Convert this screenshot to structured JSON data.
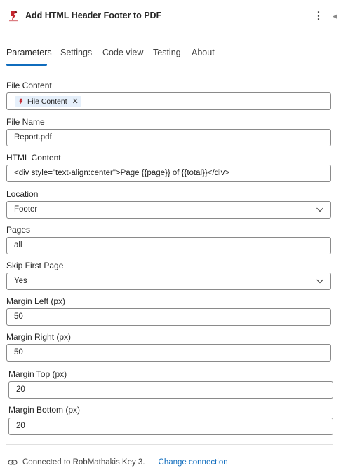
{
  "header": {
    "title": "Add HTML Header Footer to PDF"
  },
  "tabs": [
    {
      "label": "Parameters",
      "active": true
    },
    {
      "label": "Settings",
      "active": false
    },
    {
      "label": "Code view",
      "active": false
    },
    {
      "label": "Testing",
      "active": false
    },
    {
      "label": "About",
      "active": false
    }
  ],
  "fields": {
    "file_content": {
      "label": "File Content",
      "token": "File Content"
    },
    "file_name": {
      "label": "File Name",
      "value": "Report.pdf"
    },
    "html_content": {
      "label": "HTML Content",
      "value": "<div style=\"text-align:center\">Page {{page}} of {{total}}</div>"
    },
    "location": {
      "label": "Location",
      "value": "Footer"
    },
    "pages": {
      "label": "Pages",
      "value": "all"
    },
    "skip_first_page": {
      "label": "Skip First Page",
      "value": "Yes"
    },
    "margin_left": {
      "label": "Margin Left (px)",
      "value": "50"
    },
    "margin_right": {
      "label": "Margin Right (px)",
      "value": "50"
    },
    "margin_top": {
      "label": "Margin Top (px)",
      "value": "20"
    },
    "margin_bottom": {
      "label": "Margin Bottom (px)",
      "value": "20"
    }
  },
  "footer": {
    "connection_text": "Connected to RobMathakis Key 3.",
    "change_link": "Change connection"
  },
  "colors": {
    "accent": "#0f6cbd",
    "border": "#8a8a8a",
    "token_bg": "#e6f0fb",
    "logo_red": "#c4262e"
  },
  "icons": {
    "app": "robot-logo-icon",
    "menu": "more-vertical-icon",
    "collapse": "collapse-panel-icon",
    "dropdown": "chevron-down-icon",
    "connection": "link-icon"
  }
}
